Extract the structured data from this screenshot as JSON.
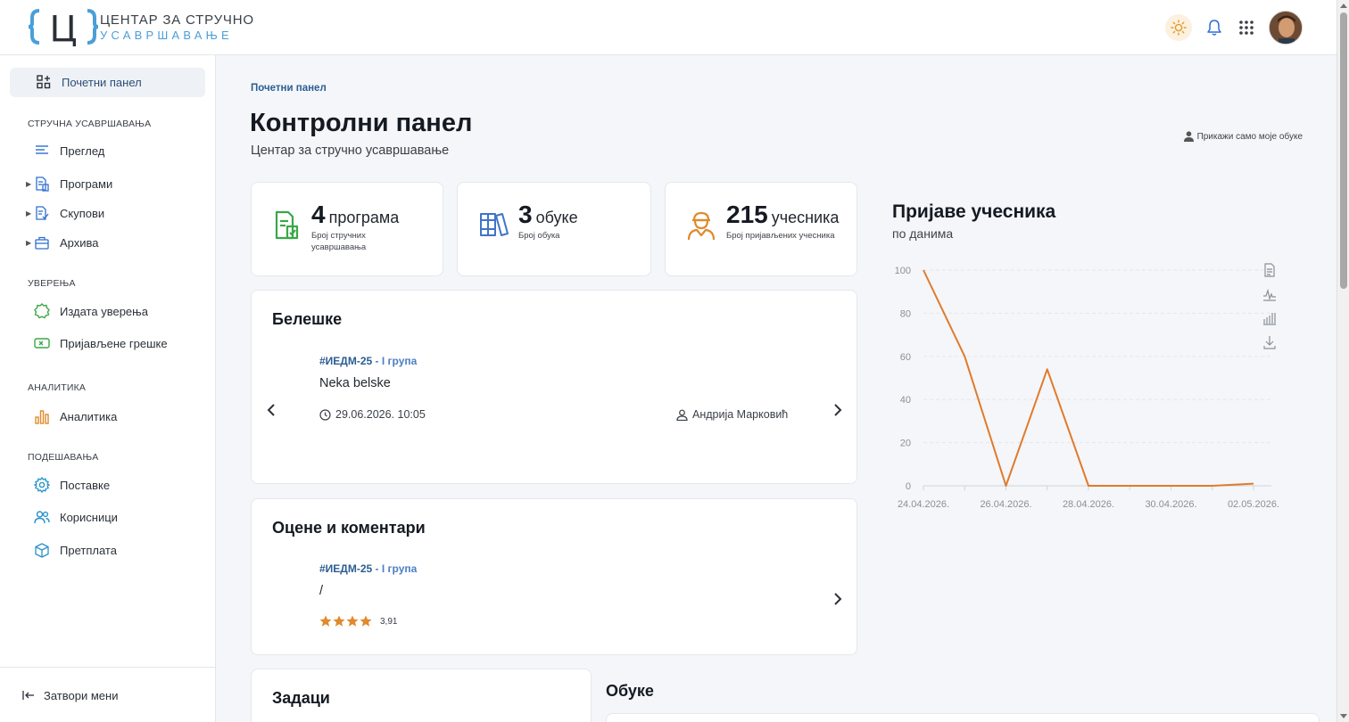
{
  "brand": {
    "logo_letter": "Ц",
    "line1": "ЦЕНТАР ЗА СТРУЧНО",
    "line2": "УСАВРШАВАЊЕ",
    "accent_color": "#4a9fd8"
  },
  "header_icons": [
    "theme-toggle-icon",
    "bell-icon",
    "apps-grid-icon",
    "avatar"
  ],
  "sidebar": {
    "home": "Почетни панел",
    "sections": [
      {
        "title": "СТРУЧНА УСАВРШАВАЊА",
        "items": [
          "Преглед",
          "Програми",
          "Скупови",
          "Архива"
        ]
      },
      {
        "title": "УВЕРЕЊА",
        "items": [
          "Издата уверења",
          "Пријављене грешке"
        ]
      },
      {
        "title": "АНАЛИТИКА",
        "items": [
          "Аналитика"
        ]
      },
      {
        "title": "ПОДЕШАВАЊА",
        "items": [
          "Поставке",
          "Корисници",
          "Претплата"
        ]
      }
    ],
    "close_menu": "Затвори мени"
  },
  "main": {
    "breadcrumb": "Почетни панел",
    "title": "Контролни панел",
    "subtitle": "Центар за стручно усавршавање",
    "my_trainings_toggle": "Прикажи само моје обуке",
    "stats": [
      {
        "value": "4",
        "unit": "програма",
        "desc": "Број стручних усавршавања",
        "color": "#3aa845"
      },
      {
        "value": "3",
        "unit": "обуке",
        "desc": "Број обука",
        "color": "#3f74c9"
      },
      {
        "value": "215",
        "unit": "учесника",
        "desc": "Број пријављених учесника",
        "color": "#e08a2c"
      }
    ],
    "notes": {
      "title": "Белешке",
      "tag": "#ИЕДМ-25",
      "group": " - I група",
      "text": "Neka belske",
      "datetime": "29.06.2026. 10:05",
      "author": "Андрија Марковић"
    },
    "ratings": {
      "title": "Оцене и коментари",
      "tag": "#ИЕДМ-25",
      "group": " - I група",
      "text": "/",
      "score": "3,91",
      "stars": 4
    },
    "tasks_title": "Задаци",
    "trainings_title": "Обуке"
  },
  "chart_data": {
    "type": "line",
    "title": "Пријаве учесника",
    "subtitle": "по данима",
    "x": [
      "24.04.2026.",
      "25.04.2026.",
      "26.04.2026.",
      "27.04.2026.",
      "28.04.2026.",
      "29.04.2026.",
      "30.04.2026.",
      "01.05.2026.",
      "02.05.2026."
    ],
    "x_tick_labels": [
      "24.04.2026.",
      "26.04.2026.",
      "28.04.2026.",
      "30.04.2026.",
      "02.05.2026."
    ],
    "series": [
      {
        "values": [
          100,
          60,
          0,
          54,
          0,
          0,
          0,
          0,
          1
        ],
        "color": "#e07a2c"
      }
    ],
    "ylim": [
      0,
      100
    ],
    "y_ticks": [
      0,
      20,
      40,
      60,
      80,
      100
    ],
    "grid": true,
    "toolbar_icons": [
      "document-icon",
      "line-chart-icon",
      "bar-chart-icon",
      "download-icon"
    ]
  }
}
